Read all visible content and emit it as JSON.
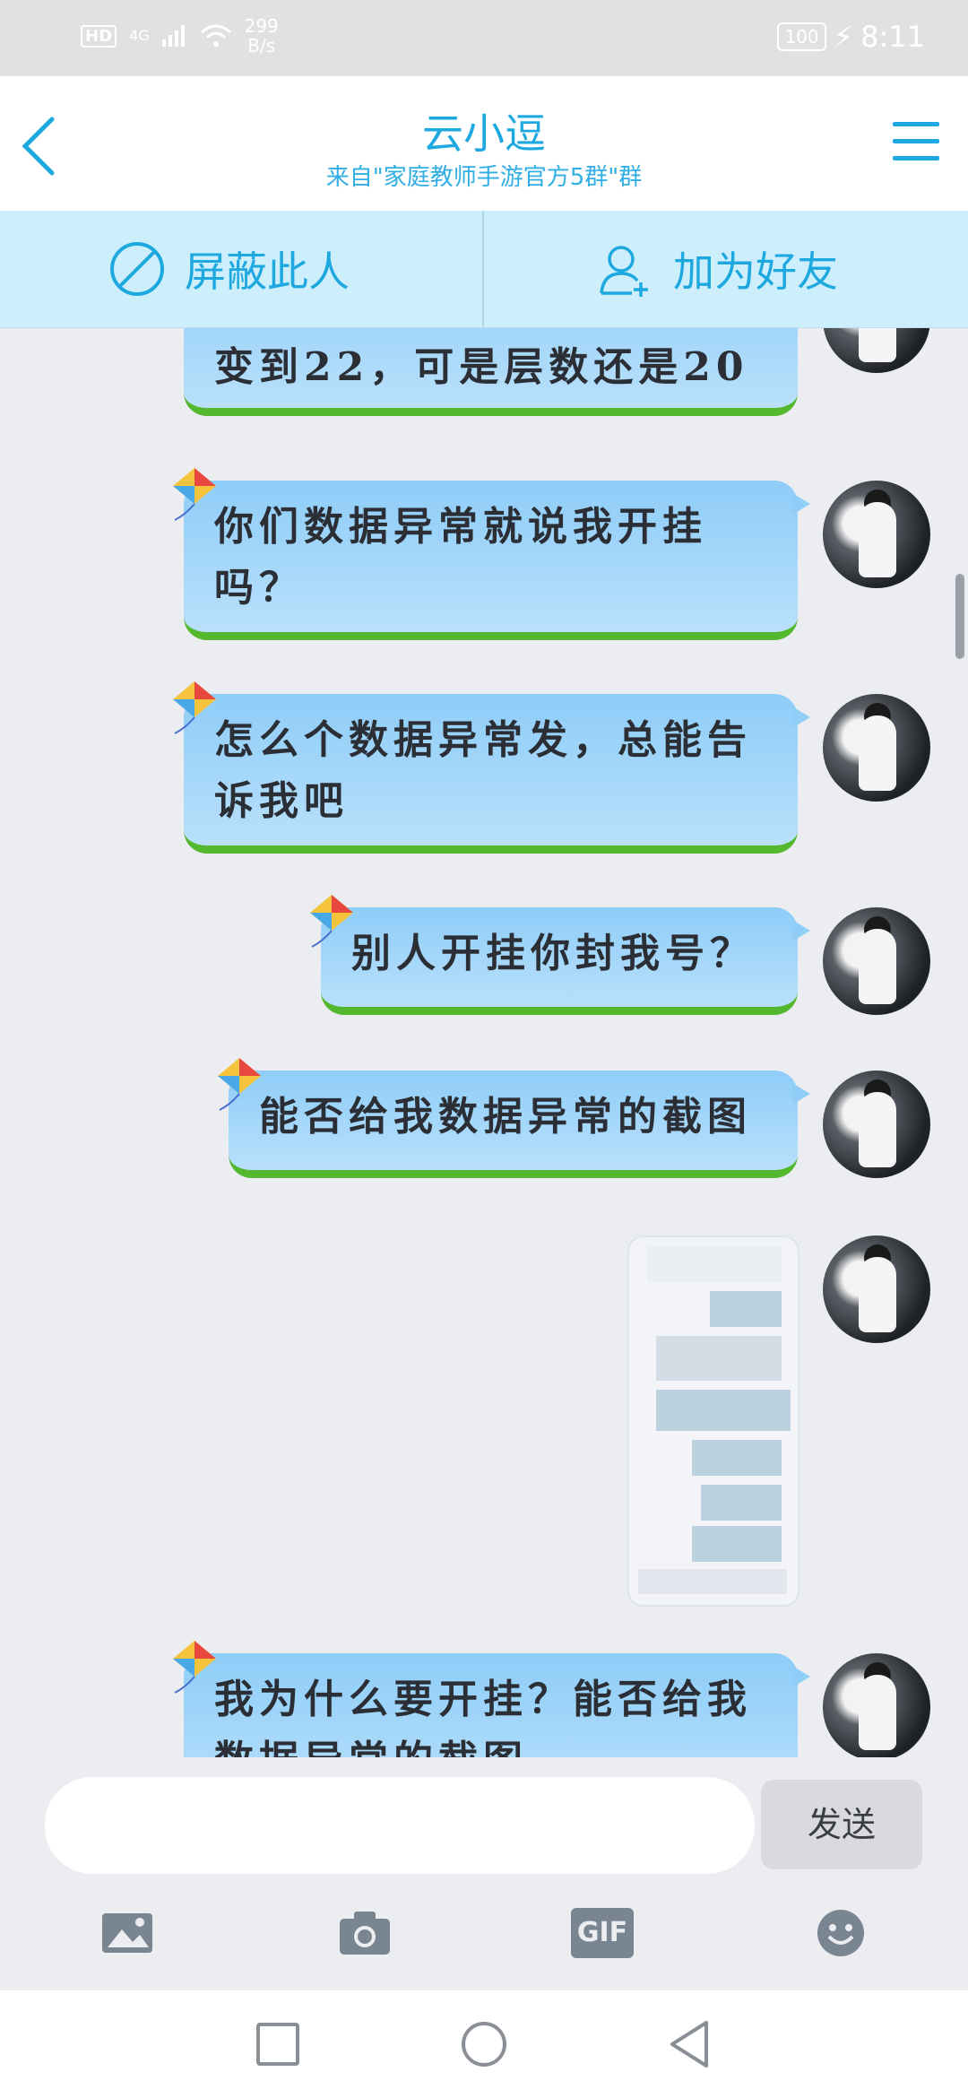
{
  "status": {
    "hd": "HD",
    "network": "4G",
    "speed_value": "299",
    "speed_unit": "B/s",
    "battery": "100",
    "time": "8:11"
  },
  "header": {
    "title": "云小逗",
    "subtitle": "来自\"家庭教师手游官方5群\"群"
  },
  "actions": {
    "block_label": "屏蔽此人",
    "add_friend_label": "加为好友"
  },
  "messages": [
    {
      "text": "变到22，可是层数还是20"
    },
    {
      "text": "你们数据异常就说我开挂吗？"
    },
    {
      "text": "怎么个数据异常发，总能告诉我吧"
    },
    {
      "text": "别人开挂你封我号？"
    },
    {
      "text": "能否给我数据异常的截图"
    },
    {
      "text": "我为什么要开挂？能否给我数据异常的截图"
    }
  ],
  "composer": {
    "placeholder": "",
    "send_label": "发送"
  },
  "toolbar": {
    "gif_label": "GIF"
  },
  "colors": {
    "accent": "#1ea8e0",
    "bubble": "#9ed5fa",
    "bubble_grass": "#54b82f"
  }
}
